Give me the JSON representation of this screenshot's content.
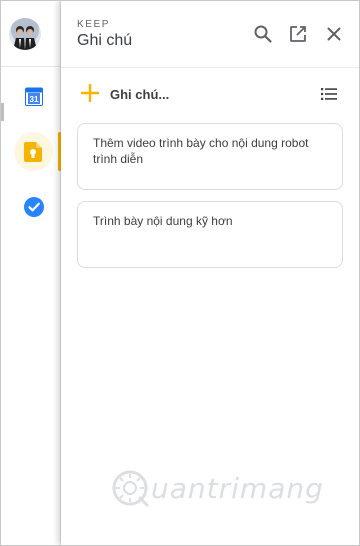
{
  "app": {
    "name": "KEEP",
    "title": "Ghi chú"
  },
  "rail": {
    "items": [
      {
        "name": "avatar"
      },
      {
        "name": "calendar",
        "badge": "31"
      },
      {
        "name": "keep",
        "active": true
      },
      {
        "name": "tasks"
      }
    ]
  },
  "header": {
    "icons": [
      "search-icon",
      "open-in-new-icon",
      "close-icon"
    ]
  },
  "take_note": {
    "label": "Ghi chú..."
  },
  "notes": [
    {
      "text": "Thêm video trình bày cho nội dung robot trình diễn"
    },
    {
      "text": "Trình bày nội dung kỹ hơn"
    }
  ],
  "watermark": {
    "text": "uantrimang"
  },
  "colors": {
    "accent": "#f4b400",
    "keep_bubble": "#fef7e0",
    "calendar_blue": "#1a73e8",
    "tasks_blue": "#2684fc",
    "text": "#3c4043",
    "border": "#dadce0"
  }
}
